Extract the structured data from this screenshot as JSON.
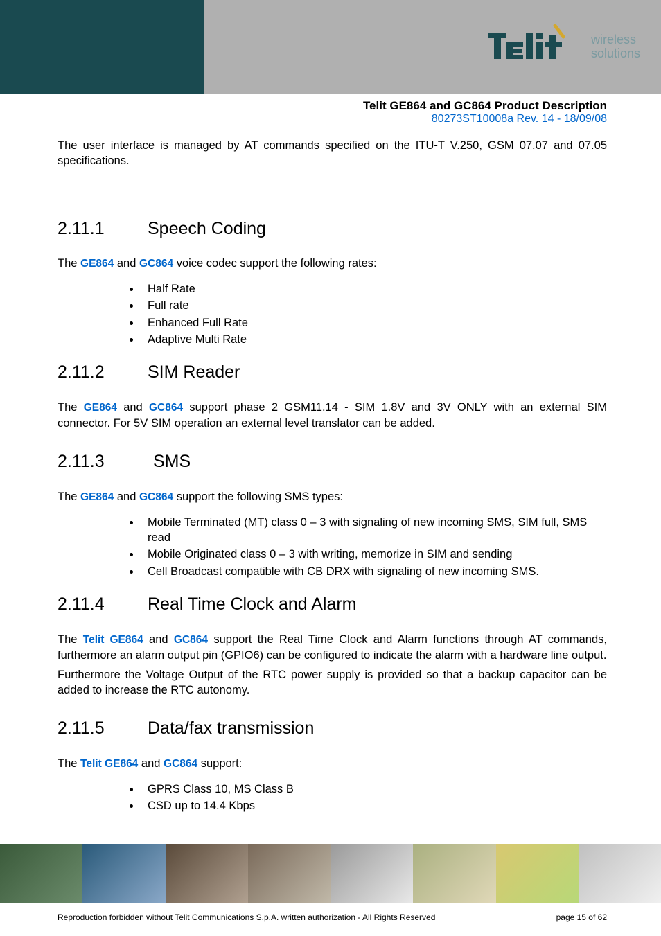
{
  "header": {
    "logo_text": "Telit",
    "logo_tagline_1": "wireless",
    "logo_tagline_2": "solutions"
  },
  "doc": {
    "title": "Telit GE864 and GC864 Product Description",
    "rev": "80273ST10008a Rev. 14 - 18/09/08"
  },
  "intro_para": "The user interface is managed by AT commands specified on the ITU-T V.250, GSM 07.07 and 07.05 specifications.",
  "sections": {
    "s1": {
      "num": "2.11.1",
      "title": "Speech Coding",
      "lead_pre": "The ",
      "link1": "GE864",
      "lead_mid": " and ",
      "link2": "GC864",
      "lead_post": " voice codec support the following rates:",
      "bullets": [
        "Half Rate",
        "Full rate",
        "Enhanced Full Rate",
        "Adaptive Multi Rate"
      ]
    },
    "s2": {
      "num": "2.11.2",
      "title": "SIM Reader",
      "lead_pre": "The ",
      "link1": "GE864",
      "lead_mid": " and ",
      "link2": "GC864",
      "lead_post": " support phase 2 GSM11.14 - SIM 1.8V and 3V ONLY with an external SIM connector. For 5V SIM operation an external level translator can be added."
    },
    "s3": {
      "num": "2.11.3",
      "title": "SMS",
      "lead_pre": "The ",
      "link1": "GE864",
      "lead_mid": " and ",
      "link2": "GC864",
      "lead_post": " support the following SMS types:",
      "bullets": [
        "Mobile Terminated (MT) class 0 – 3 with signaling of new incoming SMS, SIM full, SMS read",
        "Mobile Originated class 0 – 3 with writing, memorize in SIM and sending",
        "Cell Broadcast compatible with CB DRX with signaling of new incoming SMS."
      ]
    },
    "s4": {
      "num": "2.11.4",
      "title": "Real Time Clock and Alarm",
      "lead_pre": "The ",
      "link1": "Telit GE864",
      "lead_mid": " and ",
      "link2": "GC864",
      "lead_post": " support the Real Time Clock and Alarm functions through AT commands, furthermore an alarm output pin (GPIO6) can be configured to indicate the alarm with a hardware line output.",
      "extra": "Furthermore the Voltage Output of the RTC power supply is provided so that a backup capacitor can be added to increase the RTC autonomy."
    },
    "s5": {
      "num": "2.11.5",
      "title": "Data/fax transmission",
      "lead_pre": "The ",
      "link1": "Telit GE864",
      "lead_mid": " and ",
      "link2": "GC864",
      "lead_post": " support:",
      "bullets": [
        "GPRS Class 10, MS Class B",
        "CSD up to 14.4 Kbps"
      ]
    }
  },
  "footer": {
    "copyright": "Reproduction forbidden without Telit Communications S.p.A. written authorization - All Rights Reserved",
    "page": "page 15 of 62"
  }
}
